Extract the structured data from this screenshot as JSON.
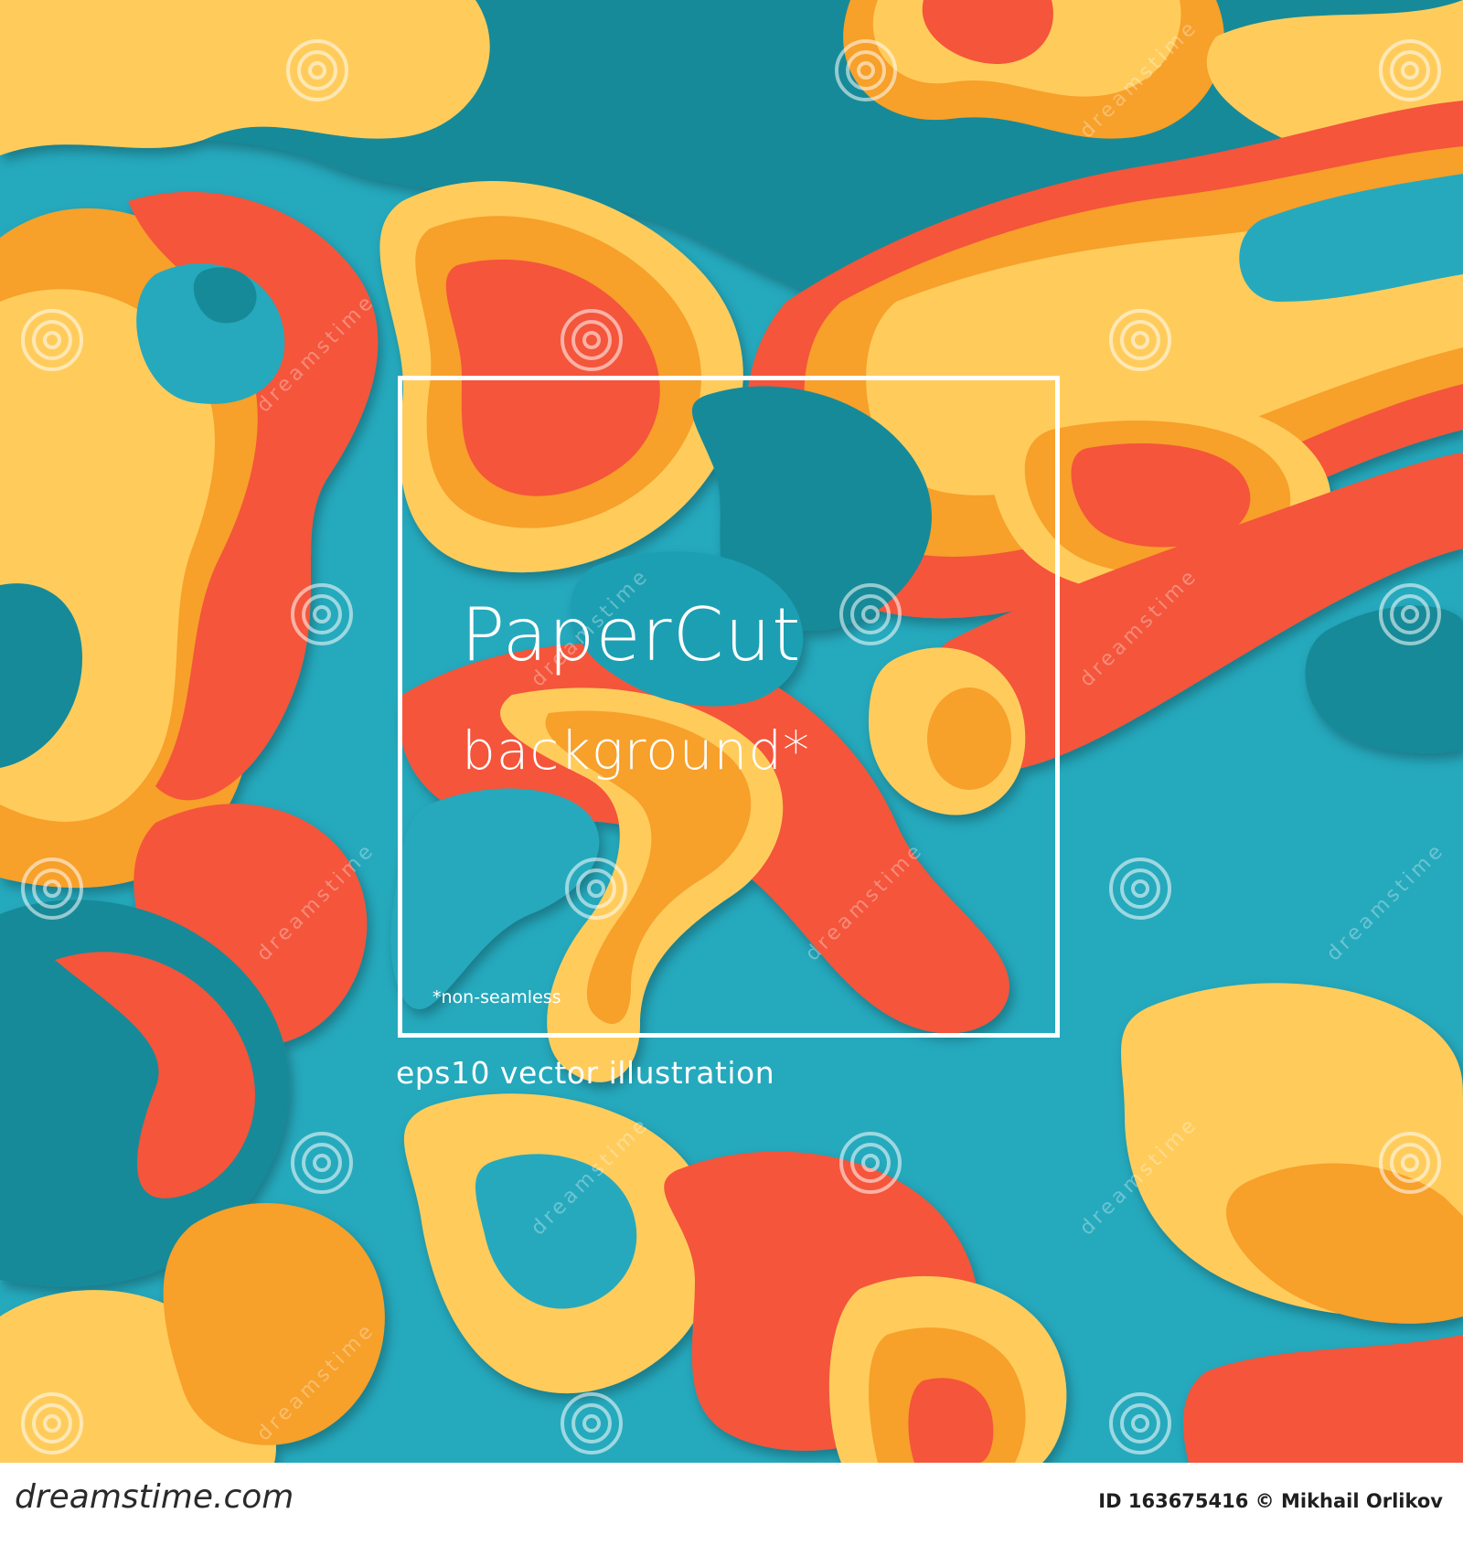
{
  "artwork": {
    "title": "PaperCut",
    "subtitle": "background*",
    "note": "*non-seamless",
    "caption": "eps10 vector illustration",
    "palette": {
      "teal_dark": "#168a98",
      "teal": "#25a9bd",
      "teal_light": "#4fc3d0",
      "yellow": "#ffcc5c",
      "orange": "#f7a02a",
      "red": "#f4553a"
    }
  },
  "watermark": {
    "text": "dreamstime",
    "icon": "spiral-logo-icon"
  },
  "footer": {
    "site": "dreamstime.com",
    "image_id": "ID 163675416 © Mikhail Orlikov"
  }
}
